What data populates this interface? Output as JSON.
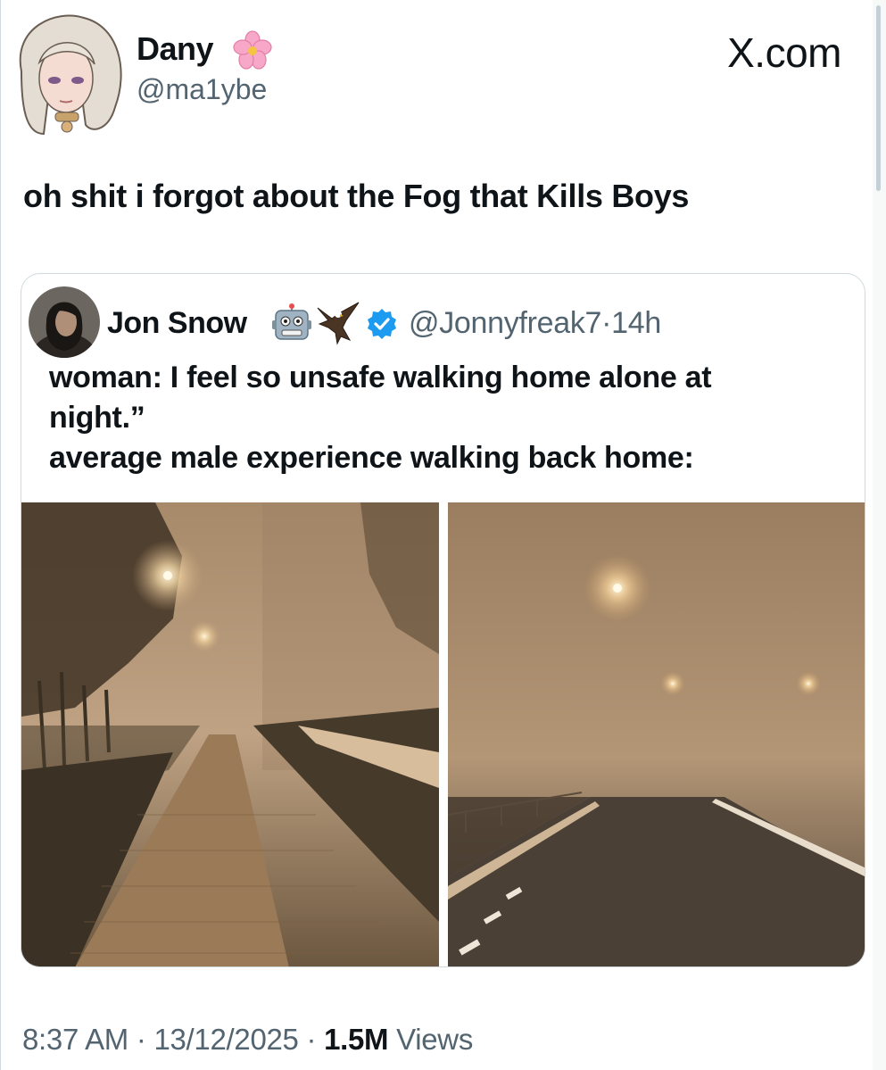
{
  "author": {
    "display_name": "Dany",
    "handle": "@ma1ybe",
    "avatar_icon": "anime-girl-avatar",
    "name_emoji": "cherry-blossom-icon"
  },
  "brand": {
    "label": "X.com"
  },
  "tweet": {
    "text": "oh shit i forgot about the Fog that Kills Boys"
  },
  "quote": {
    "display_name": "Jon Snow",
    "name_emojis": [
      "robot-icon",
      "eagle-icon"
    ],
    "verified": true,
    "handle": "@Jonnyfreak7",
    "separator": "·",
    "time": "14h",
    "text_lines": [
      "woman: I feel so unsafe walking home alone at",
      "night.”",
      "average male experience walking back home:"
    ],
    "photos": [
      "foggy-sidewalk-photo",
      "foggy-road-photo"
    ]
  },
  "footer": {
    "time": "8:37 AM",
    "dot": "·",
    "date": "13/12/2025",
    "views_count": "1.5M",
    "views_label": "Views"
  },
  "colors": {
    "text": "#0f1419",
    "secondary": "#536471",
    "border": "#cfd9de",
    "verified": "#1d9bf0"
  }
}
